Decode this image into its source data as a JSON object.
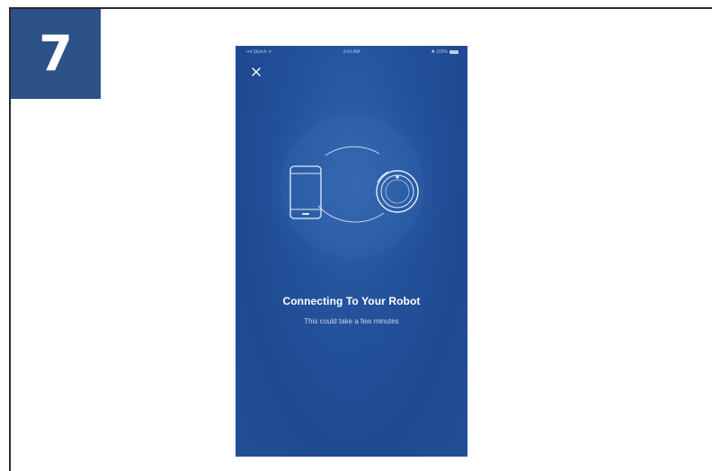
{
  "step": {
    "number": "7",
    "badge_color": "#2c5287"
  },
  "phone_screen": {
    "background_color": "#24539c",
    "status_bar": {
      "carrier": "••ıl Sketch ᯤ",
      "time": "9:41 AM",
      "battery": "✱ 100%"
    },
    "close_icon": "close-icon",
    "illustration": {
      "left_icon": "smartphone-icon",
      "right_icon": "robot-vacuum-icon"
    },
    "title": "Connecting To Your Robot",
    "subtitle": "This could take a few minutes"
  }
}
